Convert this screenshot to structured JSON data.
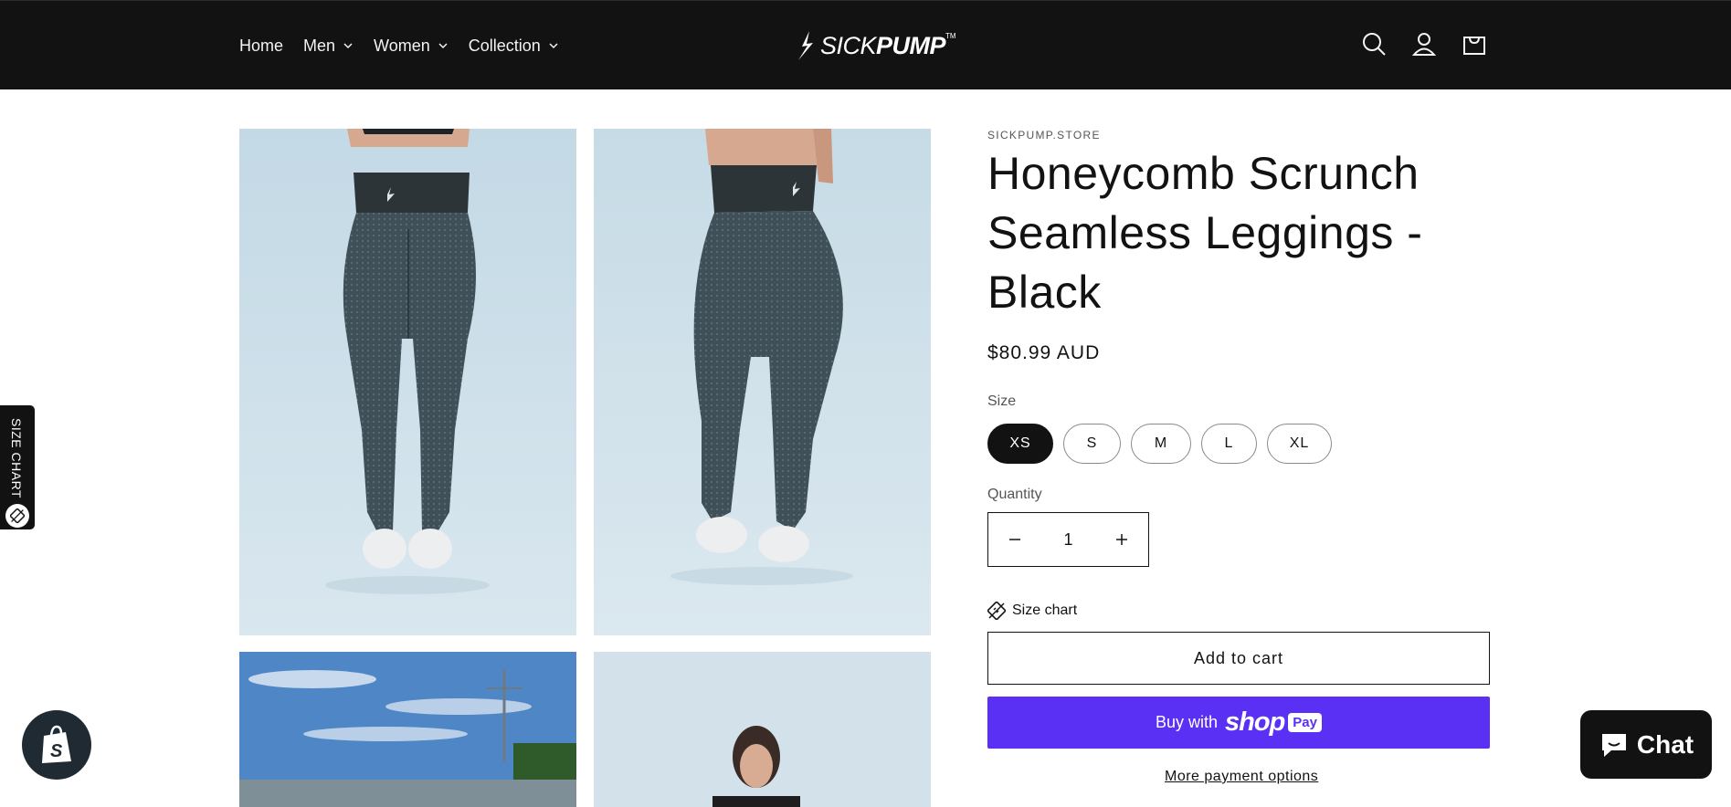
{
  "header": {
    "nav": [
      {
        "label": "Home",
        "has_dropdown": false
      },
      {
        "label": "Men",
        "has_dropdown": true
      },
      {
        "label": "Women",
        "has_dropdown": true
      },
      {
        "label": "Collection",
        "has_dropdown": true
      }
    ],
    "logo": {
      "thin": "SICK",
      "bold": "PUMP",
      "tm": "TM"
    },
    "icons": [
      "search-icon",
      "account-icon",
      "cart-icon"
    ]
  },
  "product": {
    "vendor": "SICKPUMP.STORE",
    "title": "Honeycomb Scrunch Seamless Leggings - Black",
    "price": "$80.99 AUD",
    "size_label": "Size",
    "sizes": [
      "XS",
      "S",
      "M",
      "L",
      "XL"
    ],
    "selected_size": "XS",
    "quantity_label": "Quantity",
    "quantity": "1",
    "size_chart_label": "Size chart",
    "add_to_cart": "Add to cart",
    "buy_with": "Buy with",
    "shop_word": "shop",
    "pay_word": "Pay",
    "more_payment": "More payment options"
  },
  "side_tab": {
    "label": "SIZE CHART"
  },
  "chat": {
    "label": "Chat"
  },
  "colors": {
    "header_bg": "#121212",
    "shop_pay": "#5a31f4",
    "image_bg": "#c6dbe6",
    "leggings": "#3f5058"
  }
}
